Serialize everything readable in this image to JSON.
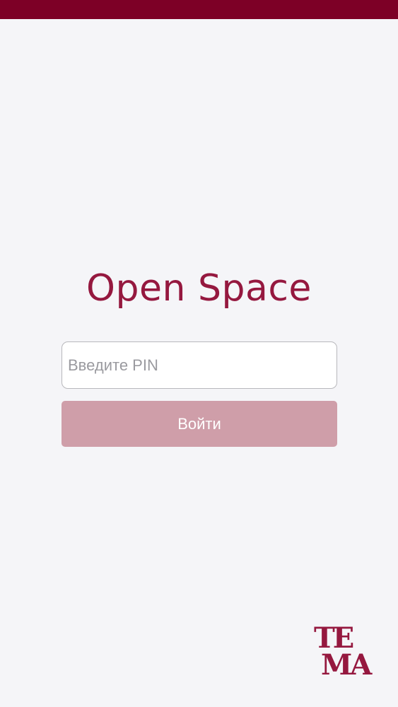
{
  "app": {
    "title": "Open Space"
  },
  "login": {
    "pin_placeholder": "Введите PIN",
    "pin_value": "",
    "submit_label": "Войти"
  },
  "logo": {
    "line1": "TE",
    "line2": "MA"
  },
  "colors": {
    "brand": "#7d0026",
    "title": "#95183f",
    "button_disabled": "#cf9ea9",
    "background": "#f5f5f8"
  }
}
